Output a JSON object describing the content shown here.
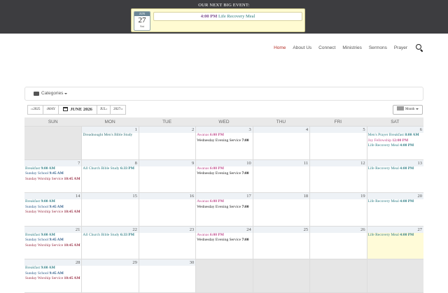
{
  "banner": {
    "title": "OUR NEXT BIG EVENT:",
    "date_month": "JUN",
    "date_day": "27",
    "date_weekday": "Sat",
    "event_time": "4:00 PM",
    "event_name": "Life Recovery Meal"
  },
  "nav": {
    "items": [
      "Home",
      "About Us",
      "Connect",
      "Ministries",
      "Sermons",
      "Prayer"
    ],
    "active": "Home"
  },
  "categories": {
    "label": "Categories"
  },
  "month_nav": {
    "prev_year": "2025",
    "prev_month": "MAY",
    "current": "JUNE 2026",
    "next_month": "JUL",
    "next_year": "2027",
    "view_label": "Month"
  },
  "calendar": {
    "weekdays": [
      "SUN",
      "MON",
      "TUE",
      "WED",
      "THU",
      "FRI",
      "SAT"
    ],
    "weeks": [
      [
        {
          "day": "",
          "out": true,
          "events": []
        },
        {
          "day": "1",
          "events": [
            {
              "name": "Dreadnought Men's Bible Study",
              "time": "",
              "color": "c-tealdark"
            }
          ]
        },
        {
          "day": "2",
          "events": []
        },
        {
          "day": "3",
          "events": [
            {
              "name": "Awanas",
              "time": "6:00 PM",
              "color": "c-pink"
            },
            {
              "name": "Wednesday Evening Service",
              "time": "7:00",
              "color": "c-dark"
            }
          ]
        },
        {
          "day": "4",
          "events": []
        },
        {
          "day": "5",
          "events": []
        },
        {
          "day": "6",
          "events": [
            {
              "name": "Men's Prayer Breakfast",
              "time": "8:00 AM",
              "color": "c-teal"
            },
            {
              "name": "Joy Fellowship",
              "time": "12:00 PM",
              "color": "c-pink"
            },
            {
              "name": "Life Recovery Meal",
              "time": "4:00 PM",
              "color": "c-teal"
            }
          ]
        }
      ],
      [
        {
          "day": "7",
          "events": [
            {
              "name": "Breakfast",
              "time": "9:00 AM",
              "color": "c-teal"
            },
            {
              "name": "Sunday School",
              "time": "9:45 AM",
              "color": "c-blue"
            },
            {
              "name": "Sunday Worship Service",
              "time": "10:45 AM",
              "color": "c-maroon"
            }
          ]
        },
        {
          "day": "8",
          "events": [
            {
              "name": "All Church Bible Study",
              "time": "6:33 PM",
              "color": "c-teal"
            }
          ]
        },
        {
          "day": "9",
          "events": []
        },
        {
          "day": "10",
          "events": [
            {
              "name": "Awanas",
              "time": "6:00 PM",
              "color": "c-pink"
            },
            {
              "name": "Wednesday Evening Service",
              "time": "7:00",
              "color": "c-dark"
            }
          ]
        },
        {
          "day": "11",
          "events": []
        },
        {
          "day": "12",
          "events": []
        },
        {
          "day": "13",
          "events": [
            {
              "name": "Life Recovery Meal",
              "time": "4:00 PM",
              "color": "c-teal"
            }
          ]
        }
      ],
      [
        {
          "day": "14",
          "events": [
            {
              "name": "Breakfast",
              "time": "9:00 AM",
              "color": "c-teal"
            },
            {
              "name": "Sunday School",
              "time": "9:45 AM",
              "color": "c-blue"
            },
            {
              "name": "Sunday Worship Service",
              "time": "10:45 AM",
              "color": "c-maroon"
            }
          ]
        },
        {
          "day": "15",
          "events": []
        },
        {
          "day": "16",
          "events": []
        },
        {
          "day": "17",
          "events": [
            {
              "name": "Awanas",
              "time": "6:00 PM",
              "color": "c-pink"
            },
            {
              "name": "Wednesday Evening Service",
              "time": "7:00",
              "color": "c-dark"
            }
          ]
        },
        {
          "day": "18",
          "events": []
        },
        {
          "day": "19",
          "events": []
        },
        {
          "day": "20",
          "events": [
            {
              "name": "Life Recovery Meal",
              "time": "4:00 PM",
              "color": "c-teal"
            }
          ]
        }
      ],
      [
        {
          "day": "21",
          "events": [
            {
              "name": "Breakfast",
              "time": "9:00 AM",
              "color": "c-teal"
            },
            {
              "name": "Sunday School",
              "time": "9:45 AM",
              "color": "c-blue"
            },
            {
              "name": "Sunday Worship Service",
              "time": "10:45 AM",
              "color": "c-maroon"
            }
          ]
        },
        {
          "day": "22",
          "events": [
            {
              "name": "All Church Bible Study",
              "time": "6:33 PM",
              "color": "c-teal"
            }
          ]
        },
        {
          "day": "23",
          "events": []
        },
        {
          "day": "24",
          "events": [
            {
              "name": "Awanas",
              "time": "6:00 PM",
              "color": "c-pink"
            },
            {
              "name": "Wednesday Evening Service",
              "time": "7:00",
              "color": "c-dark"
            }
          ]
        },
        {
          "day": "25",
          "events": []
        },
        {
          "day": "26",
          "events": []
        },
        {
          "day": "27",
          "today": true,
          "events": [
            {
              "name": "Life Recovery Meal",
              "time": "4:00 PM",
              "color": "c-teal"
            }
          ]
        }
      ],
      [
        {
          "day": "28",
          "events": [
            {
              "name": "Breakfast",
              "time": "9:00 AM",
              "color": "c-teal"
            },
            {
              "name": "Sunday School",
              "time": "9:45 AM",
              "color": "c-blue"
            },
            {
              "name": "Sunday Worship Service",
              "time": "10:45 AM",
              "color": "c-maroon"
            }
          ]
        },
        {
          "day": "29",
          "events": []
        },
        {
          "day": "30",
          "events": []
        },
        {
          "day": "",
          "out": true,
          "events": []
        },
        {
          "day": "",
          "out": true,
          "events": []
        },
        {
          "day": "",
          "out": true,
          "events": []
        },
        {
          "day": "",
          "out": true,
          "events": []
        }
      ]
    ]
  }
}
